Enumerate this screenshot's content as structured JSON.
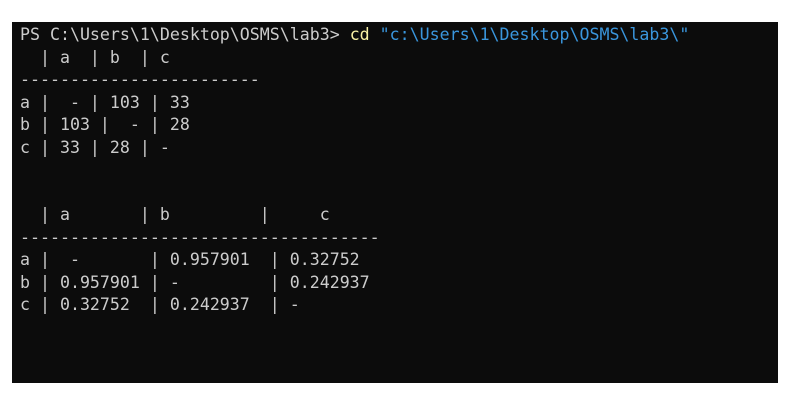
{
  "prompt": {
    "text": "PS C:\\Users\\1\\Desktop\\OSMS\\lab3> ",
    "command": "cd",
    "argument": " \"c:\\Users\\1\\Desktop\\OSMS\\lab3\\\""
  },
  "table1": {
    "header": "  | a  | b  | c",
    "separator": "------------------------",
    "rows": [
      "a |  - | 103 | 33",
      "b | 103 |  - | 28",
      "c | 33 | 28 | -"
    ]
  },
  "table2": {
    "header": "  | a       | b         |     c",
    "separator": "------------------------------------",
    "rows": [
      "a |  -       | 0.957901  | 0.32752",
      "b | 0.957901 | -         | 0.242937",
      "c | 0.32752  | 0.242937  | -"
    ]
  }
}
